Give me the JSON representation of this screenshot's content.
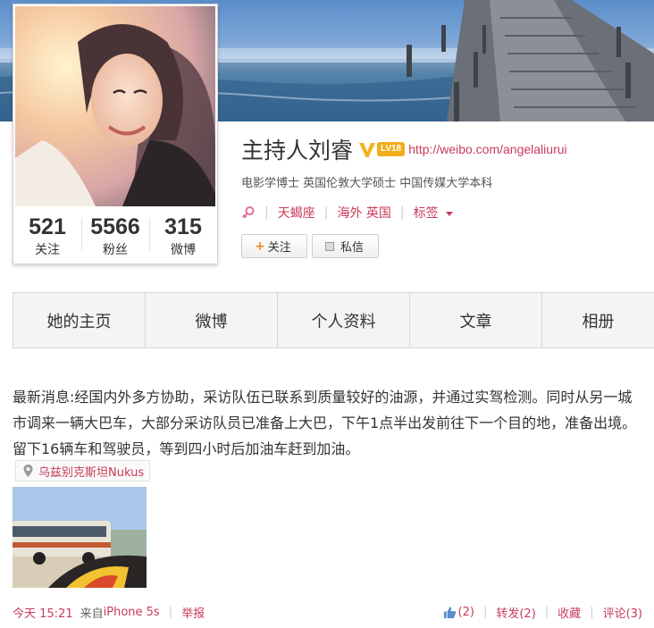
{
  "profile": {
    "name": "主持人刘睿",
    "verified_icon": "verified-v-icon",
    "level_badge": "LV18",
    "homepage_url": "http://weibo.com/angelaliurui",
    "bio": "电影学博士 英国伦敦大学硕士 中国传媒大学本科",
    "gender_icon": "female-icon",
    "zodiac": "天蝎座",
    "location": "海外 英国",
    "tags_label": "标签",
    "follow_label": "关注",
    "message_label": "私信",
    "stats": [
      {
        "value": "521",
        "label": "关注"
      },
      {
        "value": "5566",
        "label": "粉丝"
      },
      {
        "value": "315",
        "label": "微博"
      }
    ]
  },
  "tabs": [
    {
      "label": "她的主页"
    },
    {
      "label": "微博"
    },
    {
      "label": "个人资料"
    },
    {
      "label": "文章"
    },
    {
      "label": "相册"
    }
  ],
  "post": {
    "text": "最新消息:经国内外多方协助，采访队伍已联系到质量较好的油源，并通过实驾检测。同时从另一城市调来一辆大巴车，大部分采访队员已准备上大巴，下午1点半出发前往下一个目的地，准备出境。留下16辆车和驾驶员，等到四小时后加油车赶到加油。",
    "location_icon": "location-pin-icon",
    "location": "乌兹别克斯坦Nukus",
    "time": "今天 15:21",
    "source_prefix": "来自",
    "source": "iPhone 5s",
    "report": "举报",
    "like_icon": "thumbs-up-icon",
    "likes": "(2)",
    "repost": "转发(2)",
    "favorite": "收藏",
    "comment": "评论(3)"
  },
  "colors": {
    "link": "#c83b58",
    "badge": "#f2ad1a",
    "verified": "#f2b21e",
    "tab_bg": "#f4f4f4"
  }
}
